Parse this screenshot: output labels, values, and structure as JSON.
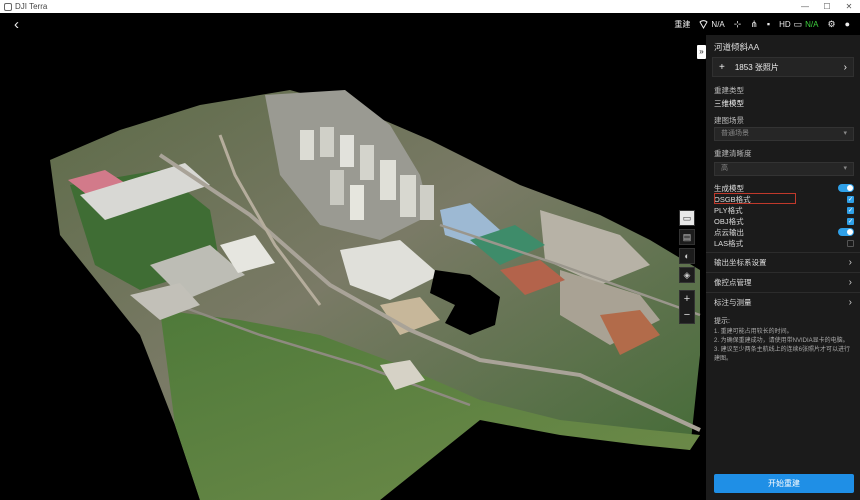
{
  "window": {
    "title": "DJI Terra",
    "controls": [
      "—",
      "☐",
      "✕"
    ]
  },
  "topbar": {
    "rebuild_label": "重建",
    "signal_value": "N/A",
    "hd_label": "HD",
    "hd_value": "N/A"
  },
  "panel": {
    "title": "河道倾斜AA",
    "photos": "1853 张照片",
    "reconstruction_type_label": "重建类型",
    "reconstruction_type_value": "三维模型",
    "scene_label": "建图场景",
    "scene_value": "普通场景",
    "resolution_label": "重建清晰度",
    "resolution_value": "高",
    "options": [
      {
        "label": "生成模型",
        "control": "toggle",
        "on": true
      },
      {
        "label": "OSGB格式",
        "control": "checkbox",
        "on": true
      },
      {
        "label": "PLY格式",
        "control": "checkbox",
        "on": true
      },
      {
        "label": "OBJ格式",
        "control": "checkbox",
        "on": true
      },
      {
        "label": "点云输出",
        "control": "toggle",
        "on": true
      },
      {
        "label": "LAS格式",
        "control": "checkbox",
        "on": false
      }
    ],
    "nav_items": [
      "输出坐标系设置",
      "像控点管理",
      "标注与测量"
    ],
    "tips": {
      "heading": "提示:",
      "lines": [
        "1. 重建可能占用较长的时间。",
        "2. 为确保重建成功，请使用带NVIDIA显卡的电脑。",
        "3. 建议至少两条主航线上的连续6张照片才可以进行建图。"
      ]
    },
    "start_button": "开始重建"
  },
  "colors": {
    "accent": "#1f8fe6",
    "hd_status": "#3ed13e",
    "highlight_box": "#c0392b"
  }
}
